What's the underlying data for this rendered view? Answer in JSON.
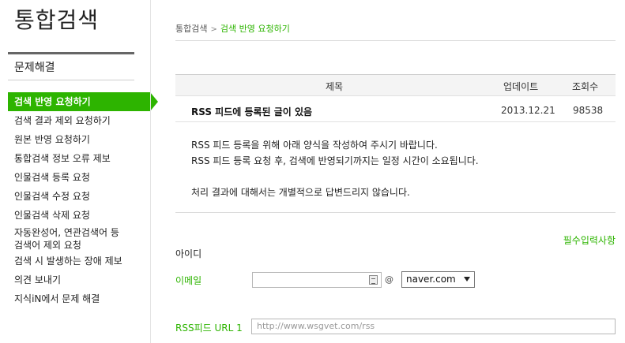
{
  "app_title": "통합검색",
  "sidebar": {
    "section_title": "문제해결",
    "items": [
      {
        "label": "검색 반영 요청하기",
        "active": true
      },
      {
        "label": "검색 결과 제외 요청하기"
      },
      {
        "label": "원본 반영 요청하기"
      },
      {
        "label": "통합검색 정보 오류 제보"
      },
      {
        "label": "인물검색 등록 요청"
      },
      {
        "label": "인물검색 수정 요청"
      },
      {
        "label": "인물검색 삭제 요청"
      },
      {
        "label_line1": "자동완성어, 연관검색어 등",
        "label_line2": "검색어 제외 요청"
      },
      {
        "label": "검색 시 발생하는 장애 제보"
      },
      {
        "label": "의견 보내기"
      },
      {
        "label": "지식iN에서 문제 해결"
      }
    ]
  },
  "breadcrumb": {
    "root": "통합검색",
    "separator": ">",
    "current": "검색 반영 요청하기"
  },
  "table": {
    "headers": [
      "제목",
      "업데이트",
      "조회수"
    ],
    "rows": [
      {
        "title": "RSS 피드에 등록된 글이 있음",
        "date": "2013.12.21",
        "views": "98538"
      }
    ]
  },
  "content": {
    "line1": "RSS 피드 등록을 위해 아래 양식을 작성하여 주시기 바랍니다.",
    "line2": "RSS 피드 등록 요청 후, 검색에 반영되기까지는 일정 시간이 소요됩니다.",
    "line3": "처리 결과에 대해서는 개별적으로 답변드리지 않습니다."
  },
  "form": {
    "required_note": "필수입력사항",
    "id_label": "아이디",
    "email_label": "이메일",
    "email_value": "",
    "at_sign": "@",
    "domain_selected": "naver.com",
    "rss_label": "RSS피드 URL 1",
    "rss_placeholder": "http://www.wsgvet.com/rss"
  },
  "colors": {
    "accent": "#2db400",
    "text": "#222222",
    "border": "#dcdcdc"
  }
}
